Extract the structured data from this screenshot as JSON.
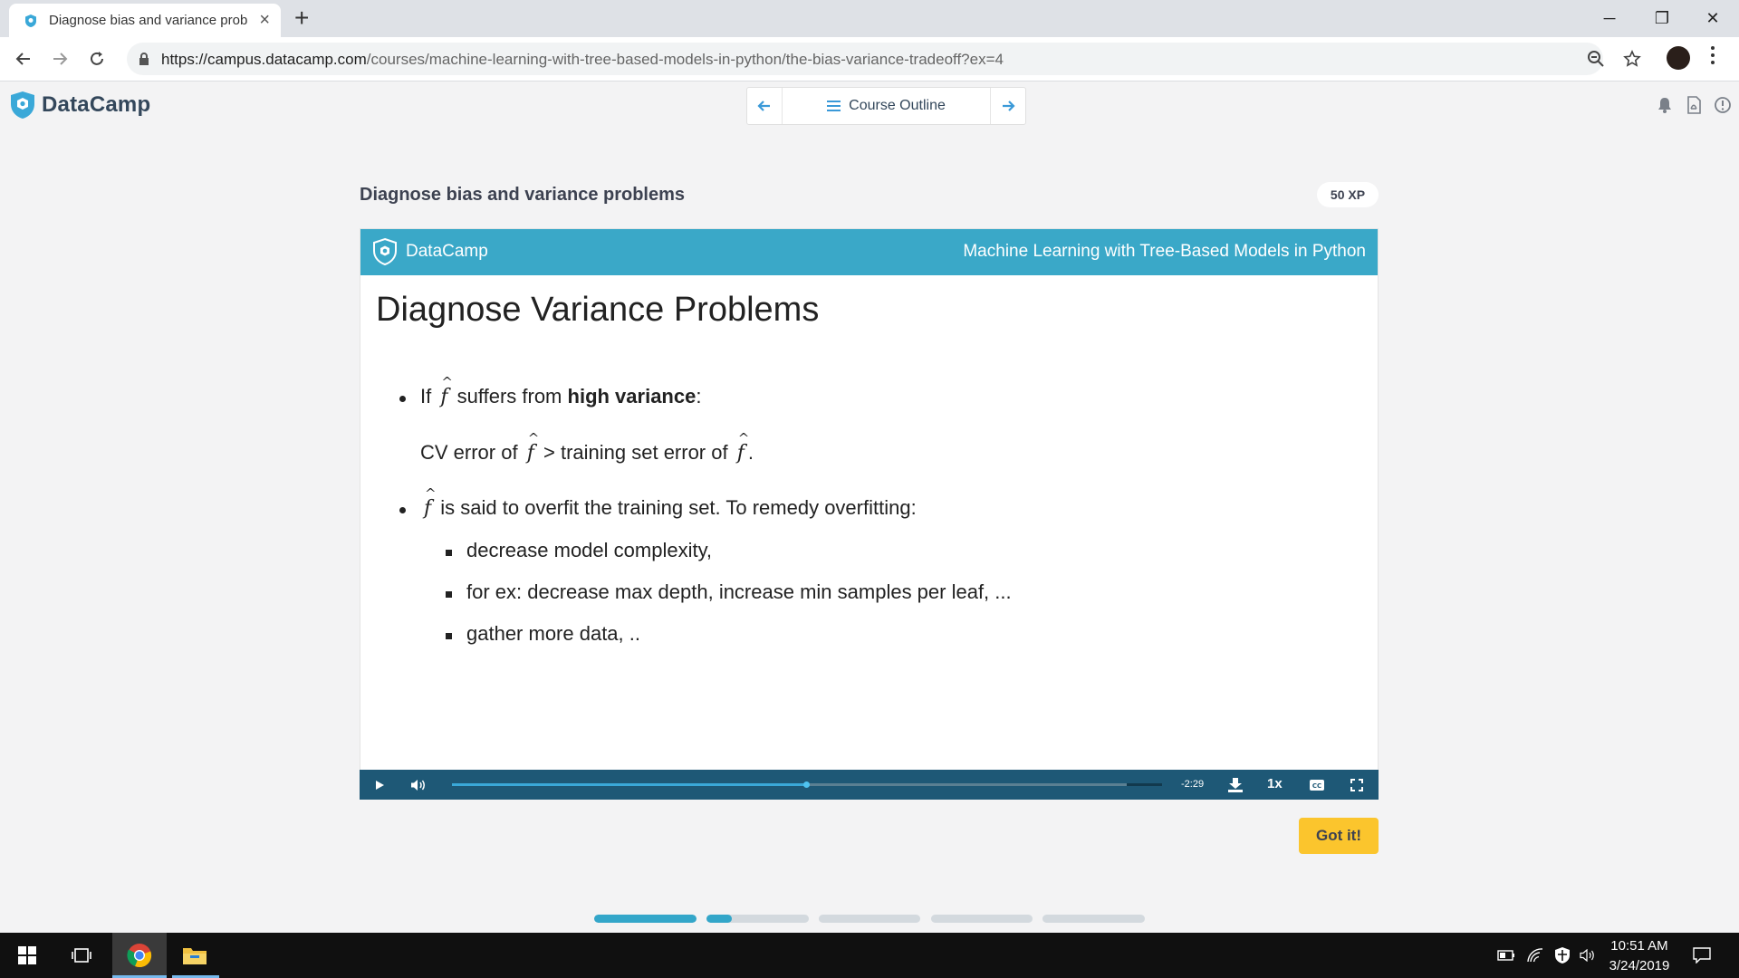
{
  "browser": {
    "tab_title": "Diagnose bias and variance prob",
    "tab_close_icon": "close-icon",
    "new_tab_label": "+",
    "url_host": "https://campus.datacamp.com",
    "url_path": "/courses/machine-learning-with-tree-based-models-in-python/the-bias-variance-tradeoff?ex=4",
    "window_minimize": "─",
    "window_restore": "❐",
    "window_close": "✕"
  },
  "header": {
    "logo_text": "DataCamp",
    "course_outline_label": "Course Outline"
  },
  "exercise": {
    "title": "Diagnose bias and variance problems",
    "xp": "50 XP",
    "got_it_label": "Got it!"
  },
  "slide": {
    "brand": "DataCamp",
    "course": "Machine Learning with Tree-Based Models in Python",
    "heading": "Diagnose Variance Problems",
    "b1_if": "If",
    "b1_suffers": "suffers from",
    "b1_bold": "high variance",
    "b1_colon": ":",
    "b1_cv": "CV error of",
    "b1_gt": "> training set error of",
    "b1_period": ".",
    "b2_text": "is said to overfit the training set. To remedy overfitting:",
    "fhat": "f",
    "sub_items": [
      "decrease model complexity,",
      "for ex: decrease max depth, increase min samples per leaf, ...",
      "gather more data, .."
    ]
  },
  "video": {
    "time_remaining": "-2:29",
    "playback_rate": "1x",
    "progress_fraction": 0.5,
    "buffered_fraction": 0.95
  },
  "slides_progress": {
    "total": 5,
    "current_index": 1,
    "current_fill_fraction": 0.25
  },
  "taskbar": {
    "time": "10:51 AM",
    "date": "3/24/2019"
  },
  "colors": {
    "slide_bar": "#3aa8c8",
    "video_bar": "#1e5876",
    "got_it": "#fbc52d",
    "progress": "#33a6c9"
  }
}
